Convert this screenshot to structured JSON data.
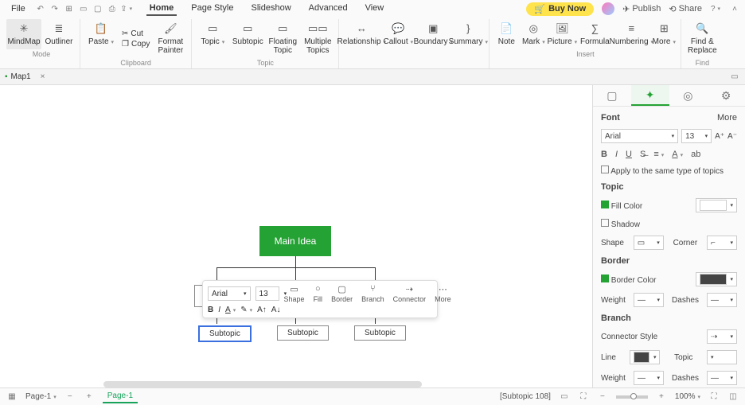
{
  "top": {
    "file": "File",
    "menu": [
      "Home",
      "Page Style",
      "Slideshow",
      "Advanced",
      "View"
    ],
    "active_menu": 0,
    "buy": "Buy Now",
    "publish": "Publish",
    "share": "Share"
  },
  "ribbon": {
    "mode": {
      "mindmap": "MindMap",
      "outliner": "Outliner",
      "label": "Mode"
    },
    "clipboard": {
      "paste": "Paste",
      "cut": "Cut",
      "copy": "Copy",
      "fp": "Format Painter",
      "label": "Clipboard"
    },
    "topic": {
      "topic": "Topic",
      "subtopic": "Subtopic",
      "floating": "Floating Topic",
      "multiple": "Multiple Topics",
      "label": "Topic"
    },
    "shape": {
      "relationship": "Relationship",
      "callout": "Callout",
      "boundary": "Boundary",
      "summary": "Summary"
    },
    "insert": {
      "note": "Note",
      "mark": "Mark",
      "picture": "Picture",
      "formula": "Formula",
      "numbering": "Numbering",
      "more": "More",
      "label": "Insert"
    },
    "find": {
      "fr": "Find & Replace",
      "label": "Find"
    }
  },
  "doc": {
    "tab": "Map1"
  },
  "canvas": {
    "main": "Main Idea",
    "sub1": "Subtopic",
    "sub2": "Subtopic",
    "sub3": "Subtopic"
  },
  "float_tb": {
    "font": "Arial",
    "size": "13",
    "shape": "Shape",
    "fill": "Fill",
    "border": "Border",
    "branch": "Branch",
    "connector": "Connector",
    "more": "More"
  },
  "side": {
    "font": {
      "title": "Font",
      "more": "More",
      "family": "Arial",
      "size": "13",
      "apply": "Apply to the same type of topics"
    },
    "topic": {
      "title": "Topic",
      "fill": "Fill Color",
      "shadow": "Shadow",
      "shape": "Shape",
      "corner": "Corner"
    },
    "border": {
      "title": "Border",
      "color": "Border Color",
      "weight": "Weight",
      "dashes": "Dashes"
    },
    "branch": {
      "title": "Branch",
      "connstyle": "Connector Style",
      "line": "Line",
      "topic": "Topic",
      "weight": "Weight",
      "dashes": "Dashes"
    }
  },
  "status": {
    "page": "Page-1",
    "tab": "Page-1",
    "sel": "[Subtopic 108]",
    "zoom": "100%"
  }
}
